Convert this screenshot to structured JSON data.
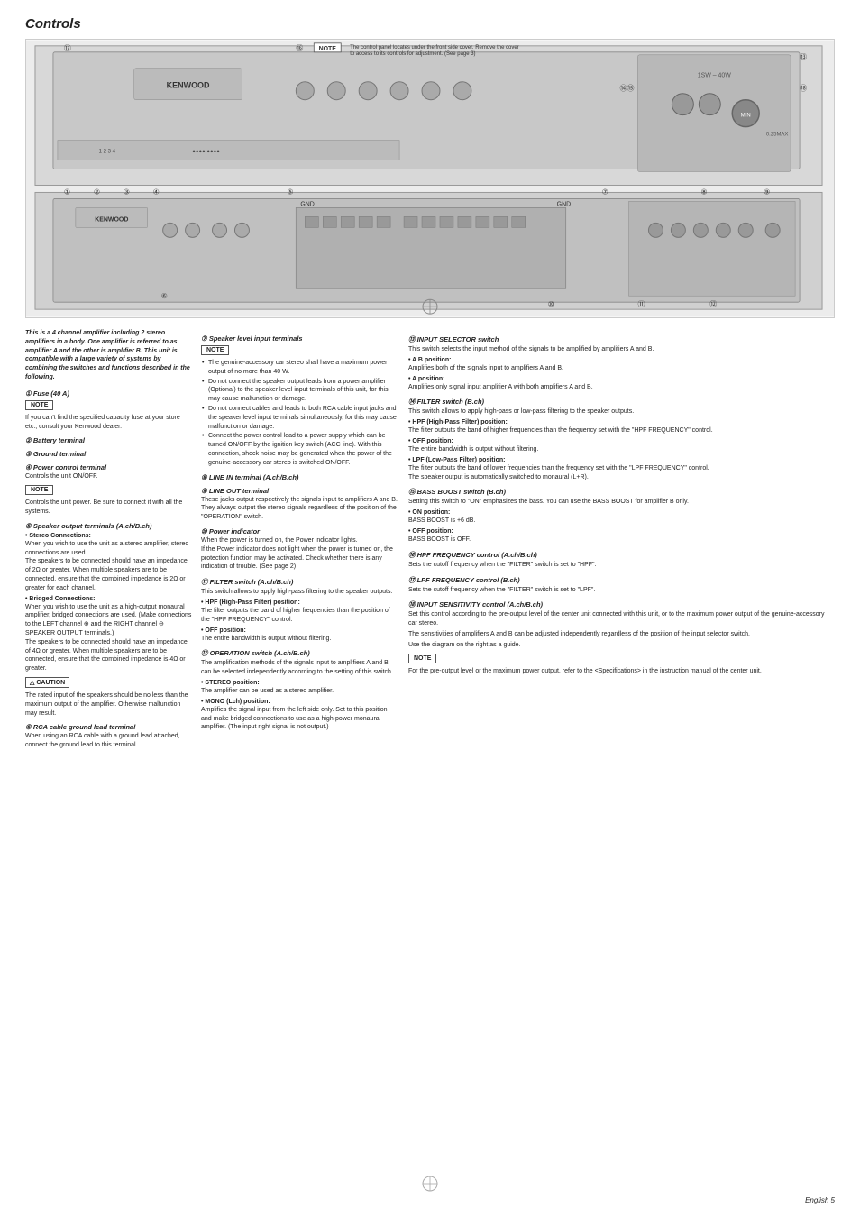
{
  "page": {
    "title": "Controls",
    "page_number": "English 5"
  },
  "diagram": {
    "note_label": "NOTE",
    "note_text": "The control panel locates under the front side cover. Remove the cover to access to its controls for adjustment. (See page 3)"
  },
  "intro": {
    "text": "This is a 4 channel amplifier including 2 stereo amplifiers in a body. One amplifier is referred to as amplifier A and the other is amplifier B. This unit is compatible with a large variety of systems by combining the switches and functions described in the following."
  },
  "items": {
    "item1": {
      "num": "① ",
      "label": "Fuse (40 A)",
      "note_label": "NOTE",
      "text": "If you can't find the specified capacity fuse at your store etc., consult your Kenwood dealer."
    },
    "item2": {
      "num": "② ",
      "label": "Battery terminal"
    },
    "item3": {
      "num": "③ ",
      "label": "Ground terminal"
    },
    "item4": {
      "num": "④ ",
      "label": "Power control terminal",
      "text1": "Controls the unit ON/OFF.",
      "note_label": "NOTE",
      "text2": "Controls the unit power. Be sure to connect it with all the systems."
    },
    "item5": {
      "num": "⑤ ",
      "label": "Speaker output terminals (A.ch/B.ch)",
      "sub1": "• Stereo Connections:",
      "stereo_text": "When you wish to use the unit as a stereo amplifier, stereo connections are used.\nThe speakers to be connected should have an impedance of 2Ω or greater. When multiple speakers are to be connected, ensure that the combined impedance is 2Ω or greater for each channel.",
      "sub2": "• Bridged Connections:",
      "bridged_text": "When you wish to use the unit as a high-output monaural amplifier, bridged connections are used. (Make connections to the LEFT channel ⊕ and the RIGHT channel ⊖ SPEAKER OUTPUT terminals.)\nThe speakers to be connected should have an impedance of 4Ω or greater. When multiple speakers are to be connected, ensure that the combined impedance is 4Ω or greater.",
      "caution_label": "△ CAUTION",
      "caution_text": "The rated input of the speakers should be no less than the maximum output of the amplifier. Otherwise malfunction may result."
    },
    "item6": {
      "num": "⑥ ",
      "label": "RCA cable ground lead terminal",
      "text": "When using an RCA cable with a ground lead attached, connect the ground lead to this terminal."
    },
    "item7": {
      "num": "⑦ ",
      "label": "Speaker level input terminals",
      "note_label": "NOTE",
      "bullets": [
        "The genuine-accessory car stereo shall have a maximum power output of no more than 40 W.",
        "Do not connect the speaker output leads from a power amplifier (Optional) to the speaker level input terminals of this unit, for this may cause malfunction or damage.",
        "Do not connect cables and leads to both RCA cable input jacks and the speaker level input terminals simultaneously, for this may cause malfunction or damage.",
        "Connect the power control lead to a power supply which can be turned ON/OFF by the ignition key switch (ACC line). With this connection, shock noise may be generated when the power of the genuine-accessory car stereo is switched ON/OFF."
      ]
    },
    "item8": {
      "num": "⑧ ",
      "label": "LINE IN terminal (A.ch/B.ch)"
    },
    "item9": {
      "num": "⑨ ",
      "label": "LINE OUT terminal",
      "text": "These jacks output respectively the signals input to amplifiers A and B.\nThey always output the stereo signals regardless of the position of the \"OPERATION\" switch."
    },
    "item10": {
      "num": "⑩ ",
      "label": "Power indicator",
      "text": "When the power is turned on, the Power indicator lights.\nIf the Power indicator does not light when the power is turned on, the protection function may be activated. Check whether there is any indication of trouble. (See page 2)"
    },
    "item11": {
      "num": "⑪ ",
      "label": "FILTER switch (A.ch/B.ch)",
      "text": "This switch allows to apply high-pass filtering to the speaker outputs.",
      "sub1": "• HPF (High-Pass Filter) position:",
      "hpf_text": "The filter outputs the band of higher frequencies than the position of the \"HPF FREQUENCY\" control.",
      "sub2": "• OFF position:",
      "off_text": "The entire bandwidth is output without filtering."
    },
    "item12": {
      "num": "⑫ ",
      "label": "OPERATION switch (A.ch/B.ch)",
      "text": "The amplification methods of the signals input to amplifiers A and B can be selected independently according to the setting of this switch.",
      "sub1": "• STEREO position:",
      "stereo_text": "The amplifier can be used as a stereo amplifier.",
      "sub2": "• MONO (Lch) position:",
      "mono_text": "Amplifies the signal input from the left side only. Set to this position and make bridged connections to use as a high-power monaural amplifier. (The input right signal is not output.)"
    },
    "item13": {
      "num": "⑬ ",
      "label": "INPUT SELECTOR switch",
      "text": "This switch selects the input method of the signals to be amplified by amplifiers A and B.",
      "sub1": "• A B position:",
      "ab_text": "Amplifies both of the signals input to amplifiers A and B.",
      "sub2": "• A position:",
      "a_text": "Amplifies only signal input amplifier A with both amplifiers A and B."
    },
    "item14": {
      "num": "⑭ ",
      "label": "FILTER switch (B.ch)",
      "text": "This switch allows to apply high-pass or low-pass filtering to the speaker outputs.",
      "sub1": "• HPF (High-Pass Filter) position:",
      "hpf_text": "The filter outputs the band of higher frequencies than the frequency set with the \"HPF FREQUENCY\" control.",
      "sub2": "• OFF position:",
      "off_text": "The entire bandwidth is output without filtering.",
      "sub3": "• LPF (Low-Pass Filter) position:",
      "lpf_text": "The filter outputs the band of lower frequencies than the frequency set with the \"LPF FREQUENCY\" control.\nThe speaker output is automatically switched to monaural (L+R)."
    },
    "item15": {
      "num": "⑮ ",
      "label": "BASS BOOST switch (B.ch)",
      "text": "Setting this switch to \"ON\" emphasizes the bass. You can use the BASS BOOST for amplifier B only.",
      "sub1": "• ON position:",
      "on_text": "BASS BOOST is +6 dB.",
      "sub2": "• OFF position:",
      "off_text": "BASS BOOST is OFF."
    },
    "item16": {
      "num": "⑯ ",
      "label": "HPF FREQUENCY control (A.ch/B.ch)",
      "text": "Sets the cutoff frequency when the \"FILTER\" switch is set to \"HPF\"."
    },
    "item17": {
      "num": "⑰ ",
      "label": "LPF FREQUENCY control (B.ch)",
      "text": "Sets the cutoff frequency when the \"FILTER\" switch is set to \"LPF\"."
    },
    "item18": {
      "num": "⑱ ",
      "label": "INPUT SENSITIVITY control (A.ch/B.ch)",
      "text1": "Set this control according to the pre-output level of the center unit connected with this unit, or to the maximum power output of the genuine-accessory car stereo.",
      "text2": "The sensitivities of amplifiers A and B can be adjusted independently regardless of the position of the input selector switch.",
      "text3": "Use the diagram on the right as a guide.",
      "note_label": "NOTE",
      "note_text": "For the pre-output level or the maximum power output, refer to the <Specifications> in the instruction manual of the center unit."
    }
  }
}
